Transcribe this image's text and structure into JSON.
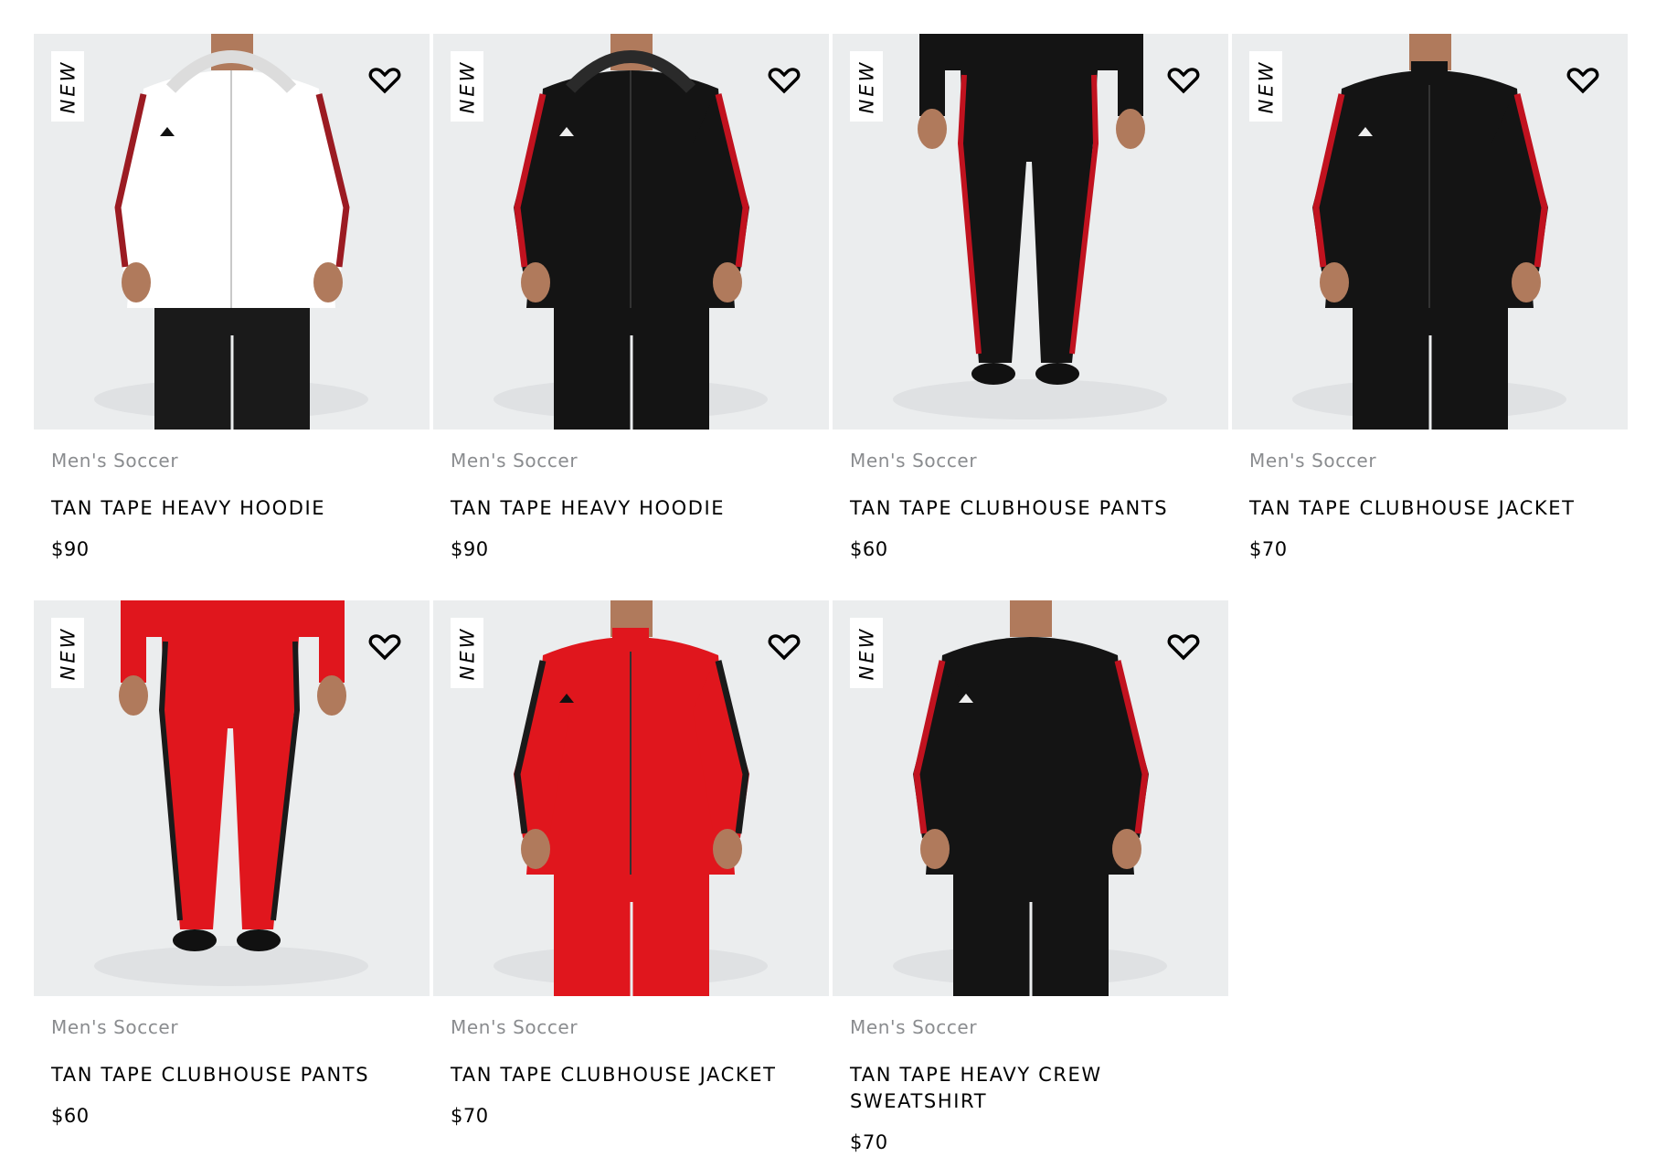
{
  "badge_label": "NEW",
  "products": [
    {
      "category": "Men's Soccer",
      "name": "TAN TAPE HEAVY HOODIE",
      "price": "$90",
      "top": "#ffffff",
      "top_tape": "#9b1b22",
      "bottom": "#1a1a1a",
      "kind": "hoodie",
      "name_lines": 1
    },
    {
      "category": "Men's Soccer",
      "name": "TAN TAPE HEAVY HOODIE",
      "price": "$90",
      "top": "#141414",
      "top_tape": "#c1121f",
      "bottom": "#141414",
      "kind": "hoodie",
      "name_lines": 1
    },
    {
      "category": "Men's Soccer",
      "name": "TAN TAPE CLUBHOUSE PANTS",
      "price": "$60",
      "top": "#141414",
      "top_tape": "#c1121f",
      "bottom": "#141414",
      "kind": "pants",
      "name_lines": 1
    },
    {
      "category": "Men's Soccer",
      "name": "TAN TAPE CLUBHOUSE JACKET",
      "price": "$70",
      "top": "#141414",
      "top_tape": "#c1121f",
      "bottom": "#141414",
      "kind": "jacket",
      "name_lines": 1
    },
    {
      "category": "Men's Soccer",
      "name": "TAN TAPE CLUBHOUSE PANTS",
      "price": "$60",
      "top": "#e0161d",
      "top_tape": "#1a1a1a",
      "bottom": "#e0161d",
      "kind": "pants",
      "name_lines": 1
    },
    {
      "category": "Men's Soccer",
      "name": "TAN TAPE CLUBHOUSE JACKET",
      "price": "$70",
      "top": "#e0161d",
      "top_tape": "#1a1a1a",
      "bottom": "#e0161d",
      "kind": "jacket",
      "name_lines": 1
    },
    {
      "category": "Men's Soccer",
      "name": "TAN TAPE HEAVY CREW SWEATSHIRT",
      "price": "$70",
      "top": "#141414",
      "top_tape": "#c1121f",
      "bottom": "#141414",
      "kind": "crew",
      "name_lines": 2
    }
  ]
}
